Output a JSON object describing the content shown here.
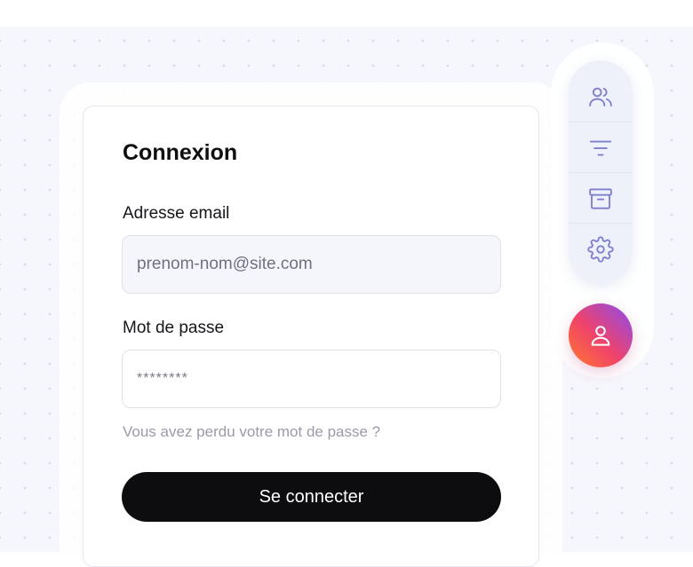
{
  "login_card": {
    "title": "Connexion",
    "email_label": "Adresse email",
    "email_placeholder": "prenom-nom@site.com",
    "password_label": "Mot de passe",
    "password_value": "********",
    "forgot_password_text": "Vous avez perdu votre mot de passe ?",
    "submit_label": "Se connecter"
  },
  "side_toolbar": {
    "items": [
      {
        "icon": "users-icon"
      },
      {
        "icon": "filter-icon"
      },
      {
        "icon": "archive-icon"
      },
      {
        "icon": "gear-icon"
      }
    ],
    "profile_icon": "user-icon"
  },
  "colors": {
    "button_bg": "#0d0d0f",
    "icon_accent": "#7f7fcf",
    "avatar_gradient": [
      "#8a4cf0",
      "#f0436a",
      "#ff7a2b"
    ]
  }
}
